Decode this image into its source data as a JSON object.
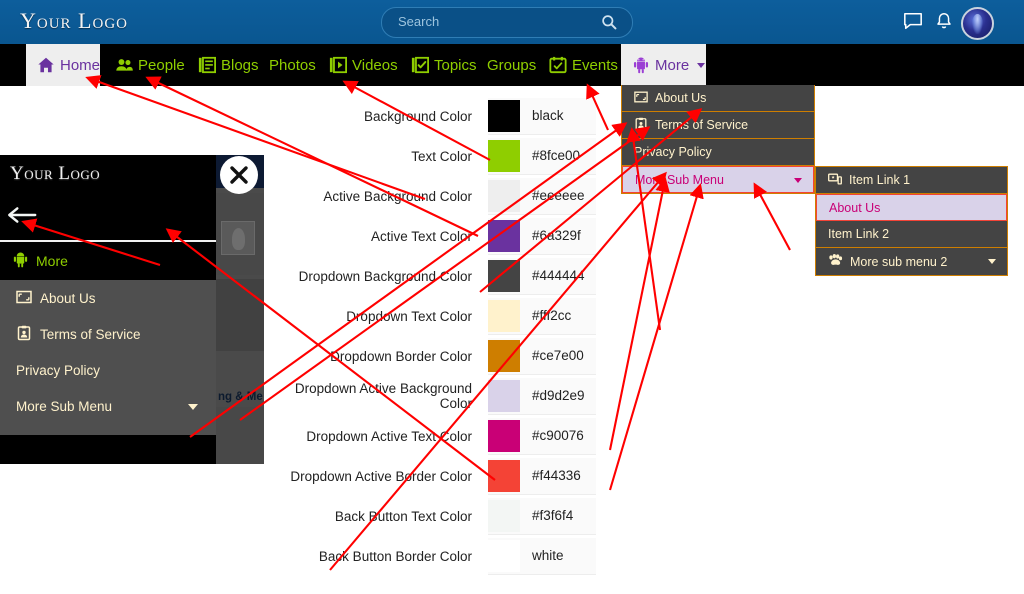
{
  "header": {
    "logo": "Your Logo",
    "search": {
      "placeholder": "Search",
      "icon": "search-icon"
    },
    "icons": [
      {
        "name": "messages-icon",
        "label": "Messages"
      },
      {
        "name": "notifications-icon",
        "label": "Notifications"
      }
    ],
    "avatar_label": "User avatar",
    "background_color": "#0b5a96"
  },
  "nav": {
    "background_color": "#000000",
    "text_color": "#8fce00",
    "active_background_color": "#eeeeee",
    "active_text_color": "#6a329f",
    "items": [
      {
        "label": "Home",
        "icon": "home-icon",
        "active": true,
        "caret": false
      },
      {
        "label": "People",
        "icon": "people-icon",
        "active": false,
        "caret": false
      },
      {
        "label": "Blogs",
        "icon": "blogs-icon",
        "active": false,
        "caret": false
      },
      {
        "label": "Photos",
        "icon": "",
        "active": false,
        "caret": false
      },
      {
        "label": "Videos",
        "icon": "videos-icon",
        "active": false,
        "caret": false
      },
      {
        "label": "Topics",
        "icon": "topics-icon",
        "active": false,
        "caret": false
      },
      {
        "label": "Groups",
        "icon": "",
        "active": false,
        "caret": false
      },
      {
        "label": "Events",
        "icon": "events-icon",
        "active": false,
        "caret": true
      },
      {
        "label": "More",
        "icon": "android-icon",
        "active": true,
        "caret": true
      }
    ]
  },
  "settings": {
    "rows": [
      {
        "label": "Background Color",
        "value": "black",
        "swatch": "#000000"
      },
      {
        "label": "Text Color",
        "value": "#8fce00",
        "swatch": "#8fce00"
      },
      {
        "label": "Active Background Color",
        "value": "#eeeeee",
        "swatch": "#eeeeee"
      },
      {
        "label": "Active Text Color",
        "value": "#6a329f",
        "swatch": "#6a329f"
      },
      {
        "label": "Dropdown Background Color",
        "value": "#444444",
        "swatch": "#444444"
      },
      {
        "label": "Dropdown Text Color",
        "value": "#fff2cc",
        "swatch": "#fff2cc"
      },
      {
        "label": "Dropdown Border Color",
        "value": "#ce7e00",
        "swatch": "#ce7e00"
      },
      {
        "label": "Dropdown Active Background Color",
        "value": "#d9d2e9",
        "swatch": "#d9d2e9"
      },
      {
        "label": "Dropdown Active Text Color",
        "value": "#c90076",
        "swatch": "#c90076"
      },
      {
        "label": "Dropdown Active Border Color",
        "value": "#f44336",
        "swatch": "#f44336"
      },
      {
        "label": "Back Button Text Color",
        "value": "#f3f6f4",
        "swatch": "#f3f6f4"
      },
      {
        "label": "Back Button Border Color",
        "value": "white",
        "swatch": "#ffffff"
      }
    ]
  },
  "more_dropdown": {
    "items": [
      {
        "label": "About Us",
        "icon": "about-us-icon",
        "active": false,
        "caret": false
      },
      {
        "label": "Terms of Service",
        "icon": "terms-icon",
        "active": false,
        "caret": false
      },
      {
        "label": "Privacy Policy",
        "icon": "",
        "active": false,
        "caret": false
      },
      {
        "label": "More Sub Menu",
        "icon": "",
        "active": true,
        "caret": true
      }
    ]
  },
  "sub_dropdown": {
    "items": [
      {
        "label": "Item Link 1",
        "icon": "item-link-icon",
        "active": false,
        "caret": false
      },
      {
        "label": "About Us",
        "icon": "",
        "active": true,
        "caret": false
      },
      {
        "label": "Item Link 2",
        "icon": "",
        "active": false,
        "caret": false
      },
      {
        "label": "More sub menu 2",
        "icon": "paws-icon",
        "active": false,
        "caret": true
      }
    ]
  },
  "mobile_preview": {
    "logo": "Your Logo",
    "back_button_label": "Back",
    "more_label": "More",
    "close_label": "Close",
    "background_text": "ng & Me",
    "items": [
      {
        "label": "About Us",
        "icon": "about-us-icon",
        "caret": false
      },
      {
        "label": "Terms of Service",
        "icon": "terms-icon",
        "caret": false
      },
      {
        "label": "Privacy Policy",
        "icon": "",
        "caret": false
      },
      {
        "label": "More Sub Menu",
        "icon": "",
        "caret": true
      }
    ]
  },
  "annotations": {
    "arrow_color": "#ff0000"
  }
}
